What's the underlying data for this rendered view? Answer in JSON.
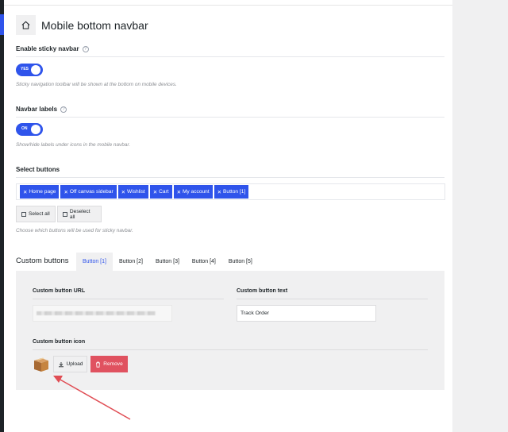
{
  "page": {
    "title": "Mobile bottom navbar"
  },
  "sticky": {
    "label": "Enable sticky navbar",
    "toggle": "YES",
    "description": "Sticky navigation toolbar will be shown at the bottom on mobile devices."
  },
  "labels": {
    "label": "Navbar labels",
    "toggle": "ON",
    "description": "Show/hide labels under icons in the mobile navbar."
  },
  "select": {
    "label": "Select buttons",
    "tags": [
      {
        "text": "Home page"
      },
      {
        "text": "Off canvas sidebar"
      },
      {
        "text": "Wishlist"
      },
      {
        "text": "Cart"
      },
      {
        "text": "My account"
      },
      {
        "text": "Button [1]"
      }
    ],
    "select_all": "Select all",
    "deselect_all": "Deselect all",
    "description": "Choose which buttons will be used for sticky navbar."
  },
  "custom": {
    "title": "Custom buttons",
    "tabs": [
      {
        "label": "Button [1]",
        "active": true
      },
      {
        "label": "Button [2]"
      },
      {
        "label": "Button [3]"
      },
      {
        "label": "Button [4]"
      },
      {
        "label": "Button [5]"
      }
    ],
    "url_label": "Custom button URL",
    "text_label": "Custom button text",
    "text_value": "Track Order",
    "icon_label": "Custom button icon",
    "upload": "Upload",
    "remove": "Remove"
  },
  "colors": {
    "accent": "#2f54eb",
    "danger": "#e05260",
    "annotation": "#e04d54"
  },
  "icons": [
    "home-icon",
    "help-icon",
    "close-icon",
    "copy-icon",
    "upload-icon",
    "trash-icon",
    "box-icon"
  ]
}
